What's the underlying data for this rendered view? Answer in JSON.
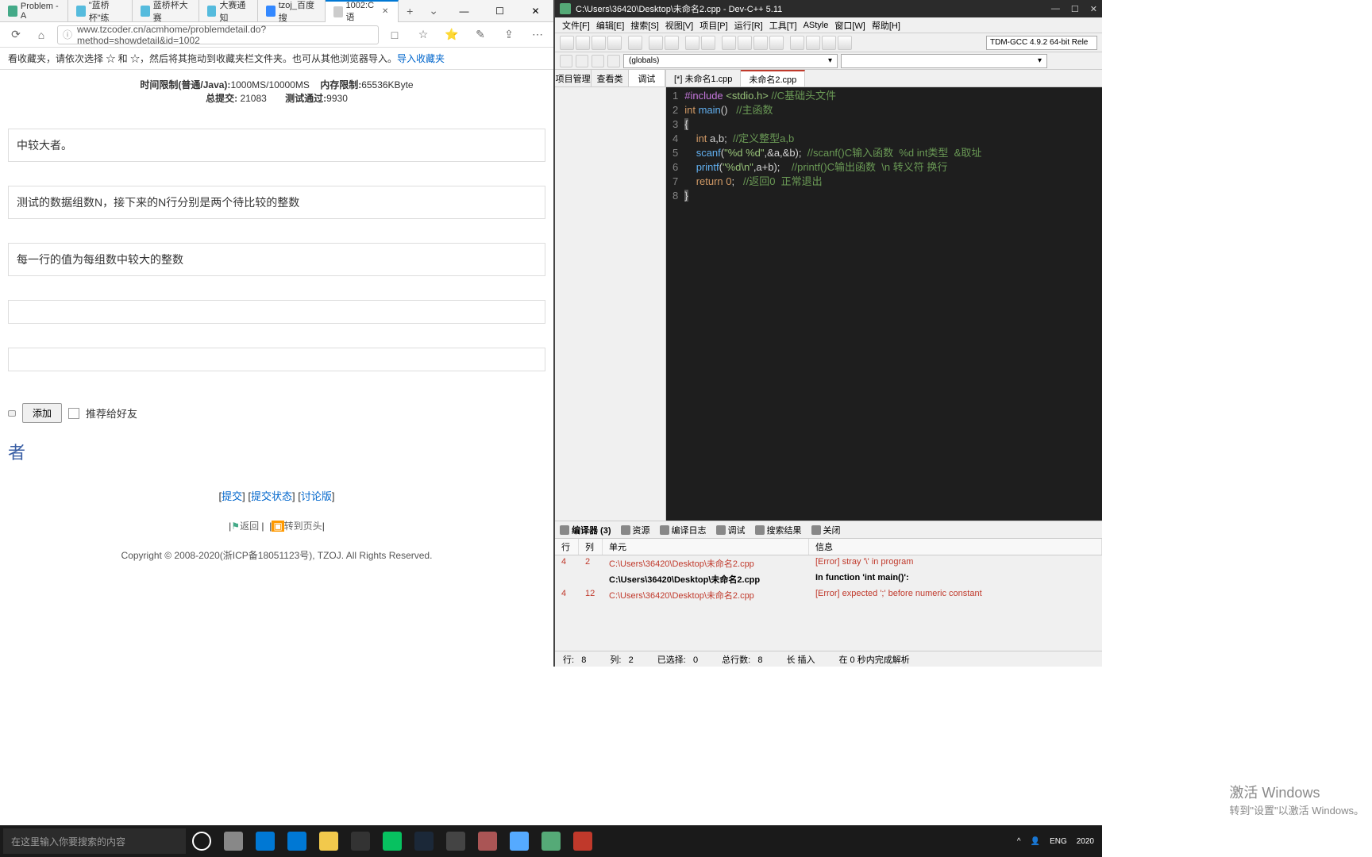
{
  "browser": {
    "tabs": [
      {
        "label": "Problem - A"
      },
      {
        "label": "\"蓝桥杯\"练"
      },
      {
        "label": "蓝桥杯大赛"
      },
      {
        "label": "大赛通知"
      },
      {
        "label": "tzoj_百度搜"
      },
      {
        "label": "1002:C语"
      }
    ],
    "url": "www.tzcoder.cn/acmhome/problemdetail.do?method=showdetail&id=1002",
    "bookmark_msg": "看收藏夹，请依次选择 ☆ 和 ☆，然后将其拖动到收藏夹栏文件夹。也可从其他浏览器导入。",
    "bookmark_link": "导入收藏夹",
    "time_limit_label": "时间限制(普通/Java):",
    "time_limit_val": "1000MS/10000MS",
    "mem_limit_label": "内存限制:",
    "mem_limit_val": "65536KByte",
    "submit_label": "总提交:",
    "submit_val": "21083",
    "ac_label": "测试通过:",
    "ac_val": "9930",
    "section1": "中较大者。",
    "section2": "测试的数据组数N，接下来的N行分别是两个待比较的整数",
    "section3": "每一行的值为每组数中较大的整数",
    "add_btn": "添加",
    "recommend": "推荐给好友",
    "big_text": "者",
    "links": {
      "submit": "提交",
      "status": "提交状态",
      "discuss": "讨论版"
    },
    "return": "返回",
    "goto": "转到页头",
    "copyright": "Copyright © 2008-2020(浙ICP备18051123号), TZOJ. All Rights Reserved."
  },
  "devcpp": {
    "title": "C:\\Users\\36420\\Desktop\\未命名2.cpp - Dev-C++ 5.11",
    "menu": [
      "文件[F]",
      "编辑[E]",
      "搜索[S]",
      "视图[V]",
      "项目[P]",
      "运行[R]",
      "工具[T]",
      "AStyle",
      "窗口[W]",
      "帮助[H]"
    ],
    "compiler_combo": "TDM-GCC 4.9.2 64-bit Rele",
    "scope_combo": "(globals)",
    "side_tabs": [
      "项目管理",
      "查看类",
      "调试"
    ],
    "file_tabs": [
      "[*] 未命名1.cpp",
      "未命名2.cpp"
    ],
    "code": {
      "lines": [
        {
          "n": 1,
          "html": "<span class='pp'>#include</span> <span class='str'>&lt;stdio.h&gt;</span> <span class='cmt'>//C基础头文件</span>"
        },
        {
          "n": 2,
          "html": "<span class='kw'>int</span> <span class='fn'>main</span>()   <span class='cmt'>//主函数</span>"
        },
        {
          "n": 3,
          "html": "<span class='br-mark'>{</span>"
        },
        {
          "n": 4,
          "html": "    <span class='kw'>int</span> a,b;  <span class='cmt'>//定义整型a,b</span>"
        },
        {
          "n": 5,
          "html": "    <span class='fn'>scanf</span>(<span class='str'>\"%d %d\"</span>,&amp;a,&amp;b);  <span class='cmt'>//scanf()C输入函数  %d int类型  &取址</span>"
        },
        {
          "n": 6,
          "html": "    <span class='fn'>printf</span>(<span class='str'>\"%d\\n\"</span>,a+b);    <span class='cmt'>//printf()C输出函数  \\n 转义符 换行</span>"
        },
        {
          "n": 7,
          "html": "    <span class='kw'>return</span> <span class='num'>0</span>;   <span class='cmt'>//返回0  正常退出</span>"
        },
        {
          "n": 8,
          "html": "<span class='br-mark'>}</span>"
        }
      ]
    },
    "bottom_tabs": {
      "compiler": "编译器 (3)",
      "resource": "资源",
      "log": "编译日志",
      "debug": "调试",
      "search": "搜索结果",
      "close": "关闭"
    },
    "table_head": {
      "line": "行",
      "col": "列",
      "unit": "单元",
      "msg": "信息"
    },
    "errors": [
      {
        "line": "4",
        "col": "2",
        "unit": "C:\\Users\\36420\\Desktop\\未命名2.cpp",
        "msg": "[Error] stray '\\' in program",
        "err": true
      },
      {
        "line": "",
        "col": "",
        "unit": "C:\\Users\\36420\\Desktop\\未命名2.cpp",
        "msg": "In function 'int main()':",
        "bold": true
      },
      {
        "line": "4",
        "col": "12",
        "unit": "C:\\Users\\36420\\Desktop\\未命名2.cpp",
        "msg": "[Error] expected ';' before numeric constant",
        "err": true
      }
    ],
    "status": {
      "row_lbl": "行:",
      "row": "8",
      "col_lbl": "列:",
      "col": "2",
      "sel_lbl": "已选择:",
      "sel": "0",
      "total_lbl": "总行数:",
      "total": "8",
      "caret": "长 插入",
      "parse": "在 0 秒内完成解析"
    }
  },
  "activate": {
    "title": "激活 Windows",
    "sub": "转到\"设置\"以激活 Windows。"
  },
  "taskbar": {
    "search_ph": "在这里输入你要搜索的内容",
    "lang": "ENG",
    "time": "2020"
  }
}
